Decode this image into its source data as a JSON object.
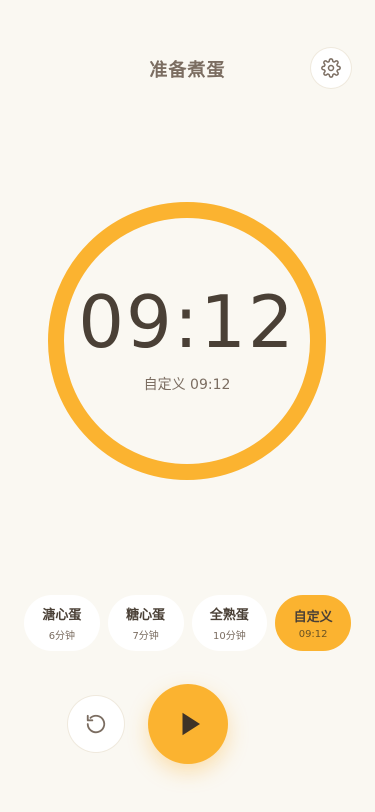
{
  "header": {
    "title": "准备煮蛋",
    "settings_icon": "gear-icon"
  },
  "timer": {
    "time": "09:12",
    "subtitle": "自定义 09:12",
    "progress": 1.0,
    "ring_color": "#fbb330"
  },
  "presets": [
    {
      "name": "溏心蛋",
      "time": "6分钟",
      "active": false
    },
    {
      "name": "糖心蛋",
      "time": "7分钟",
      "active": false
    },
    {
      "name": "全熟蛋",
      "time": "10分钟",
      "active": false
    },
    {
      "name": "自定义",
      "time": "09:12",
      "active": true
    }
  ],
  "controls": {
    "reset_icon": "reset-icon",
    "play_icon": "play-icon"
  },
  "colors": {
    "accent": "#fbb330",
    "background": "#faf8f2",
    "text_dark": "#4a4036",
    "text_muted": "#7b6d61"
  }
}
